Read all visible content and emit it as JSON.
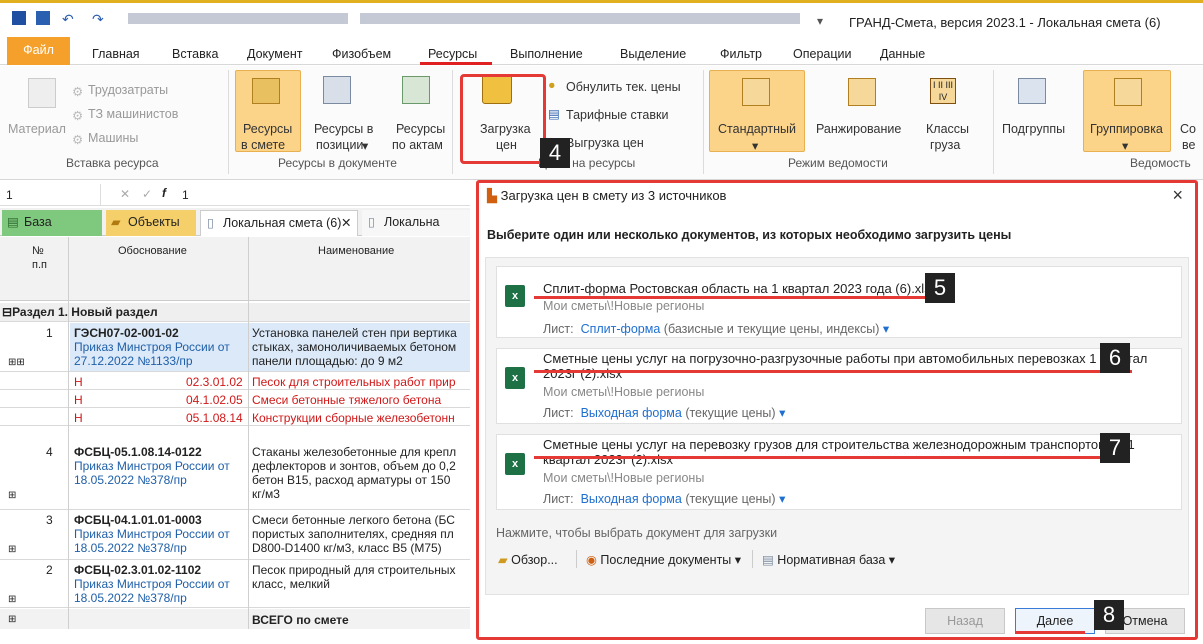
{
  "app": {
    "title": "ГРАНД-Смета, версия 2023.1 - Локальная смета (6)"
  },
  "menu": {
    "file": "Файл",
    "tabs": [
      "Главная",
      "Вставка",
      "Документ",
      "Физобъем",
      "Ресурсы",
      "Выполнение",
      "Выделение",
      "Фильтр",
      "Операции",
      "Данные"
    ]
  },
  "ribbon": {
    "insert_resource": {
      "material": "Материал",
      "labor": "Трудозатраты",
      "machinists": "ТЗ машинистов",
      "machines": "Машины",
      "caption": "Вставка ресурса"
    },
    "resources_in_doc": {
      "in_estimate": [
        "Ресурсы",
        "в смете"
      ],
      "in_positions": [
        "Ресурсы в",
        "позиции"
      ],
      "by_acts": [
        "Ресурсы",
        "по актам"
      ],
      "caption": "Ресурсы в документе"
    },
    "prices": {
      "load": [
        "Загрузка",
        "цен"
      ],
      "reset": "Обнулить тек. цены",
      "tariffs": "Тарифные ставки",
      "export": "Выгрузка цен",
      "caption": "Цены на ресурсы"
    },
    "mode": {
      "standard": "Стандартный",
      "ranking": "Ранжирование",
      "classes": [
        "Классы",
        "груза"
      ],
      "caption": "Режим ведомости"
    },
    "statement": {
      "subgroups": "Подгруппы",
      "grouping": "Группировка",
      "extra": [
        "Со",
        "ве"
      ],
      "caption": "Ведомость"
    }
  },
  "formula": {
    "cell": "1",
    "value": "1"
  },
  "doc_tabs": {
    "base": "База",
    "objects": "Объекты",
    "estimate": "Локальная смета (6)",
    "estimate2": "Локальна"
  },
  "grid": {
    "headers": {
      "num": [
        "№",
        "п.п"
      ],
      "basis": "Обоснование",
      "name": "Наименование"
    },
    "section": "Раздел 1. Новый раздел",
    "rows": [
      {
        "num": "1",
        "code": "ГЭСН07-02-001-02",
        "basis": [
          "Приказ Минстроя России от",
          "27.12.2022 №1133/пр"
        ],
        "name": [
          "Установка панелей стен при вертика",
          "стыках, замоноличиваемых бетоном",
          "панели площадью: до 9 м2"
        ]
      },
      {
        "num": "4",
        "code": "ФСБЦ-05.1.08.14-0122",
        "basis": [
          "Приказ Минстроя России от",
          "18.05.2022 №378/пр"
        ],
        "name": [
          "Стаканы железобетонные для крепл",
          "дефлекторов и зонтов, объем до 0,2",
          "бетон В15, расход арматуры от 150",
          "кг/м3"
        ]
      },
      {
        "num": "3",
        "code": "ФСБЦ-04.1.01.01-0003",
        "basis": [
          "Приказ Минстроя России от",
          "18.05.2022 №378/пр"
        ],
        "name": [
          "Смеси бетонные легкого бетона (БС",
          "пористых заполнителях, средняя пл",
          "D800-D1400 кг/м3, класс В5 (М75)"
        ]
      },
      {
        "num": "2",
        "code": "ФСБЦ-02.3.01.02-1102",
        "basis": [
          "Приказ Минстроя России от",
          "18.05.2022 №378/пр"
        ],
        "name": [
          "Песок природный для строительных",
          "класс, мелкий"
        ]
      }
    ],
    "sub_rows": [
      {
        "flag": "Н",
        "code": "02.3.01.02",
        "name": "Песок для строительных работ прир"
      },
      {
        "flag": "Н",
        "code": "04.1.02.05",
        "name": "Смеси бетонные тяжелого бетона"
      },
      {
        "flag": "Н",
        "code": "05.1.08.14",
        "name": "Конструкции сборные железобетонн"
      }
    ],
    "total": "ВСЕГО по смете"
  },
  "dialog": {
    "title": "Загрузка цен в смету из 3 источников",
    "heading": "Выберите один или несколько документов, из которых необходимо загрузить цены",
    "docs": [
      {
        "name": "Сплит-форма Ростовская область на 1 квартал 2023 года (6).xlsx",
        "path": "Мои сметы\\!Новые регионы",
        "sheet_label": "Лист:",
        "sheet": "Сплит-форма",
        "sheet_note": "(базисные и текущие цены, индексы)"
      },
      {
        "name": "Сметные цены услуг на погрузочно-разгрузочные работы при автомобильных перевозках 1 квартал 2023г (2).xlsx",
        "path": "Мои сметы\\!Новые регионы",
        "sheet_label": "Лист:",
        "sheet": "Выходная форма",
        "sheet_note": "(текущие цены)"
      },
      {
        "name": "Сметные цены услуг на перевозку грузов для строительства железнодорожным транспортом за 1 квартал 2023г (2).xlsx",
        "path": "Мои сметы\\!Новые регионы",
        "sheet_label": "Лист:",
        "sheet": "Выходная форма",
        "sheet_note": "(текущие цены)"
      }
    ],
    "hint": "Нажмите, чтобы выбрать документ для загрузки",
    "browse": "Обзор...",
    "recent": "Последние документы",
    "normbase": "Нормативная база",
    "back": "Назад",
    "next": "Далее",
    "cancel": "Отмена"
  },
  "badges": {
    "b4": "4",
    "b5": "5",
    "b6": "6",
    "b7": "7",
    "b8": "8"
  },
  "colors": {
    "accent": "#f5a02a",
    "annotation": "#e53935",
    "link": "#1f5fa8",
    "excel": "#1e7145"
  }
}
